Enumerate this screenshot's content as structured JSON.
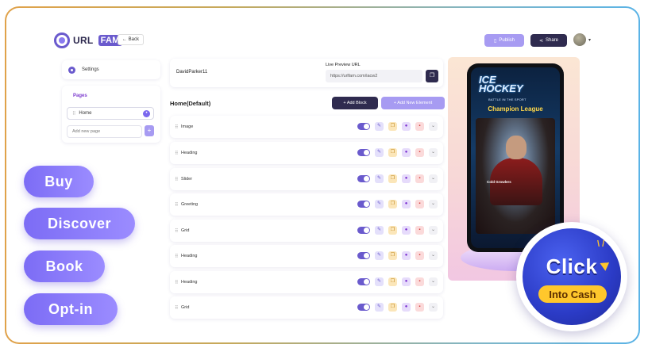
{
  "brand": {
    "logo_text": "URL",
    "logo_badge": "FAM"
  },
  "topbar": {
    "back_label": "← Back",
    "publish_label": "Publish",
    "share_label": "Share"
  },
  "sidebar": {
    "settings_label": "Settings",
    "pages_title": "Pages",
    "pages": [
      {
        "label": "Home"
      }
    ],
    "add_page_placeholder": "Add new page",
    "add_page_button": "+"
  },
  "editor": {
    "username": "DavidParker11",
    "live_preview_label": "Live Preview URL",
    "live_preview_url": "https://urlfam.com/iacw2",
    "page_title": "Home(Default)",
    "add_block_label": "+ Add Block",
    "add_element_label": "+ Add New Element",
    "blocks": [
      {
        "label": "Image"
      },
      {
        "label": "Heading"
      },
      {
        "label": "Slider"
      },
      {
        "label": "Greeting"
      },
      {
        "label": "Grid"
      },
      {
        "label": "Heading"
      },
      {
        "label": "Heading"
      },
      {
        "label": "Grid"
      }
    ]
  },
  "preview": {
    "title_line1": "ICE",
    "title_line2": "HOCKEY",
    "subtitle": "BATTLE IN THE SPORT",
    "headline": "Champion League",
    "caption": "Cold Growlers"
  },
  "ctas": {
    "buy": "Buy",
    "discover": "Discover",
    "book": "Book",
    "optin": "Opt-in"
  },
  "badge": {
    "line1": "Click",
    "line2": "Into Cash"
  },
  "colors": {
    "accent": "#6a5acd",
    "accent_light": "#a79bf2",
    "dark": "#2f2b4f",
    "badge_blue": "#2b3bc6",
    "badge_yellow": "#ffc72c"
  }
}
